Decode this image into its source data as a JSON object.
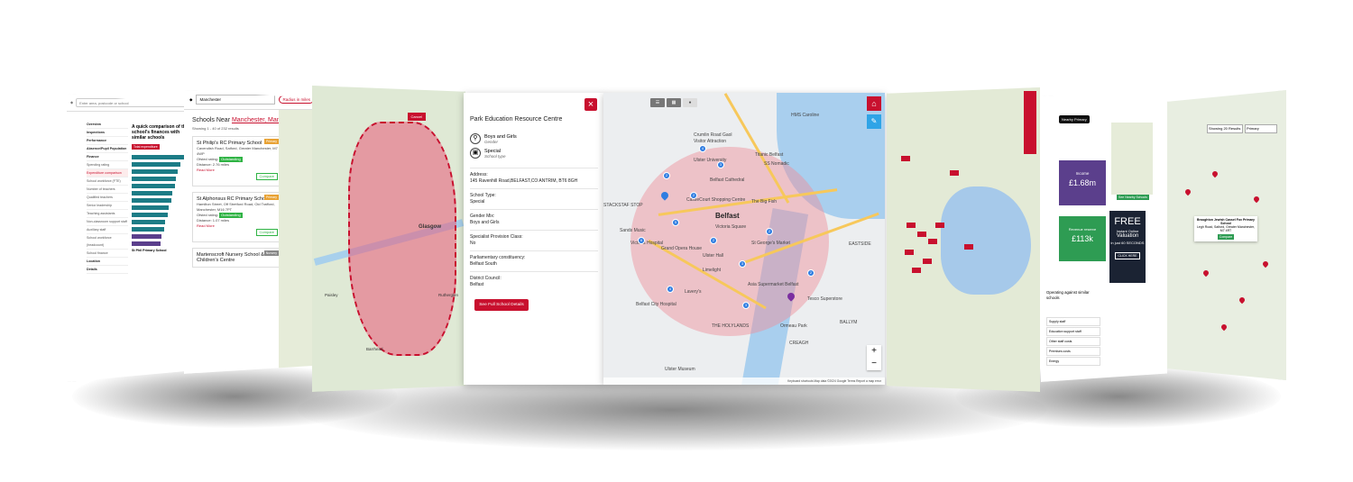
{
  "panel_left": {
    "search_placeholder": "Enter area, postcode or school",
    "nav": [
      "Overview",
      "Inspections",
      "Performance",
      "Absence/Pupil Population",
      "Finance",
      "Spending rating",
      "Expenditure comparison",
      "School workforce (FTE)",
      "Number of teachers",
      "Qualified teachers",
      "Senior leadership",
      "Teaching assistants",
      "Non-classroom support staff",
      "Auxiliary staff",
      "School workforce (headcount)",
      "School finance",
      "Location",
      "Details"
    ],
    "heading": "A quick comparison of this school's finances with similar schools",
    "tab": "Total expenditure",
    "footer_item": "St Phil Primary School"
  },
  "panel_schools": {
    "search_value": "Manchester",
    "radius_pill": "Radius in miles",
    "title_prefix": "Schools Near ",
    "title_place": "Manchester, Manchester",
    "showing": "Showing 1 - 40 of 232 results",
    "cards": [
      {
        "name": "St Philip's RC Primary School",
        "badge": "Primary",
        "address": "Cavendish Road, Salford, Greater Manchester, M7 4WP",
        "ofsted": "Outstanding",
        "distance": "Distance: 2.76 miles",
        "read_more": "Read More",
        "compare": "Compare"
      },
      {
        "name": "St Alphonsus RC Primary School",
        "badge": "Primary",
        "address": "Hamilton Street, Off Stretford Road, Old Trafford, Manchester, M16 7PT",
        "ofsted": "Outstanding",
        "distance": "Distance: 1.07 miles",
        "read_more": "Read More",
        "compare": "Compare"
      },
      {
        "name": "Martenscroft Nursery School & Children's Centre",
        "badge": "Nursery"
      }
    ],
    "ofsted_label": "Ofsted rating:"
  },
  "panel_glasgow": {
    "place": "Glasgow",
    "cancel": "Cancel",
    "places_small": [
      "Paisley",
      "Barrhead",
      "Rutherglen"
    ]
  },
  "detail": {
    "close": "×",
    "title": "Park Education Resource Centre",
    "gender_value": "Boys and Girls",
    "gender_caption": "Gender",
    "type_value": "Special",
    "type_caption": "School type",
    "address_label": "Address:",
    "address_value": "145 Ravenhill Road,BELFAST,CO ANTRIM, BT6 8GH",
    "school_type_label": "School Type:",
    "school_type_value": "Special",
    "gender_mix_label": "Gender Mix:",
    "gender_mix_value": "Boys and Girls",
    "specialist_label": "Specialist Provision Class:",
    "specialist_value": "No",
    "constituency_label": "Parliamentary constituency:",
    "constituency_value": "Belfast South",
    "council_label": "District Council:",
    "council_value": "Belfast",
    "button": "See Full School Details"
  },
  "belfast_map": {
    "places": [
      "Crumlin Road Gaol",
      "Visitor Attraction",
      "Ulster University",
      "Titanic Belfast",
      "SS Nomadic",
      "HMS Caroline",
      "Belfast Cathedral",
      "CastleCourt Shopping Centre",
      "The Big Fish",
      "Victoria Square",
      "Sands Music",
      "Grand Opera House",
      "Ulster Hall",
      "Victoria Hospital",
      "St George's Market",
      "Limelight",
      "Belfast City Hospital",
      "Asia Supermarket Belfast",
      "Tesco Superstore",
      "Lavery's",
      "THE HOLYLANDS",
      "Ormeau Park",
      "CREAGH",
      "Ulster Museum",
      "BALLYM",
      "EASTSIDE",
      "STACKSTAF STOP",
      "Belfast"
    ],
    "home_icon": "home-icon",
    "pen_icon": "brush-icon",
    "zoom_in": "+",
    "zoom_out": "−",
    "footer": "Keyboard shortcuts   Map data ©2024 Google   Terms   Report a map error",
    "hub_counts": [
      "4",
      "3",
      "2",
      "5",
      "6",
      "2",
      "3",
      "2",
      "4",
      "3",
      "2",
      "2"
    ]
  },
  "finance": {
    "tag": "Nearby Primary",
    "income_label": "Income",
    "income_value": "£1.68m",
    "reserve_label": "Revenue reserve",
    "reserve_value": "£113k",
    "promo_title": "FREE",
    "promo_sub": "Instant Online",
    "promo_valuation": "Valuation",
    "promo_time": "in just 60 SECONDS",
    "promo_cta": "CLICK HERE",
    "nearby_button": "See Nearby Schools",
    "ops_heading": "Operating against similar schools",
    "grid": [
      "Supply staff",
      "Education support staff",
      "Other staff costs",
      "Premises costs",
      "Energy"
    ]
  },
  "far_right": {
    "select1": "Showing 20 Results",
    "select2": "Primary",
    "tip_name": "Broughton Jewish Cassel Fox Primary School",
    "tip_addr": "Legh Road, Salford, Greater Manchester, M7 4RT",
    "tip_btn": "Compare"
  },
  "colors": {
    "brand": "#c8102e",
    "map_water": "#a9cfee",
    "cluster": "#2f7de1"
  }
}
